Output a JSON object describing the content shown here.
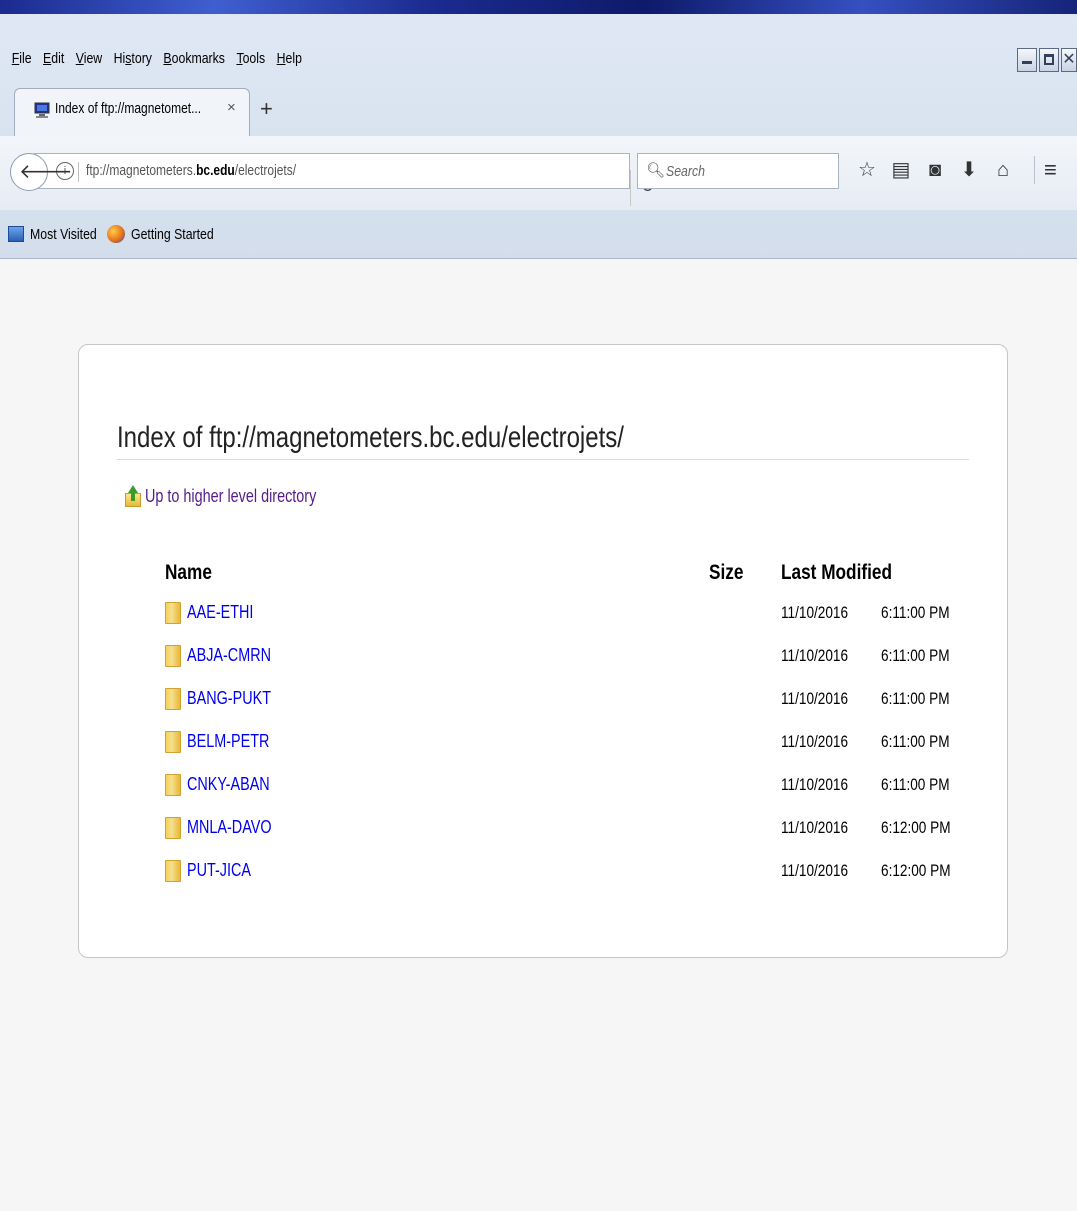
{
  "menu": [
    "File",
    "Edit",
    "View",
    "History",
    "Bookmarks",
    "Tools",
    "Help"
  ],
  "menu_access_keys": [
    "F",
    "E",
    "V",
    "s",
    "B",
    "T",
    "H"
  ],
  "tab": {
    "title": "Index of ftp://magnetomet...",
    "close": "×",
    "new_tab": "+"
  },
  "nav": {
    "url_prefix": "ftp://magnetometers.",
    "url_domain": "bc.edu",
    "url_suffix": "/electrojets/",
    "search_placeholder": "Search"
  },
  "bookmarks": [
    {
      "label": "Most Visited",
      "icon": "most-visited-icon"
    },
    {
      "label": "Getting Started",
      "icon": "firefox-icon"
    }
  ],
  "page": {
    "heading": "Index of ftp://magnetometers.bc.edu/electrojets/",
    "up_link": "Up to higher level directory",
    "columns": {
      "name": "Name",
      "size": "Size",
      "modified": "Last Modified"
    },
    "rows": [
      {
        "name": "AAE-ETHI",
        "size": "",
        "date": "11/10/2016",
        "time": "6:11:00 PM"
      },
      {
        "name": "ABJA-CMRN",
        "size": "",
        "date": "11/10/2016",
        "time": "6:11:00 PM"
      },
      {
        "name": "BANG-PUKT",
        "size": "",
        "date": "11/10/2016",
        "time": "6:11:00 PM"
      },
      {
        "name": "BELM-PETR",
        "size": "",
        "date": "11/10/2016",
        "time": "6:11:00 PM"
      },
      {
        "name": "CNKY-ABAN",
        "size": "",
        "date": "11/10/2016",
        "time": "6:11:00 PM"
      },
      {
        "name": "MNLA-DAVO",
        "size": "",
        "date": "11/10/2016",
        "time": "6:12:00 PM"
      },
      {
        "name": "PUT-JICA",
        "size": "",
        "date": "11/10/2016",
        "time": "6:12:00 PM"
      }
    ]
  },
  "colors": {
    "link": "#0000ee",
    "visited_link": "#551a8b",
    "page_bg": "#f6f6f6"
  }
}
